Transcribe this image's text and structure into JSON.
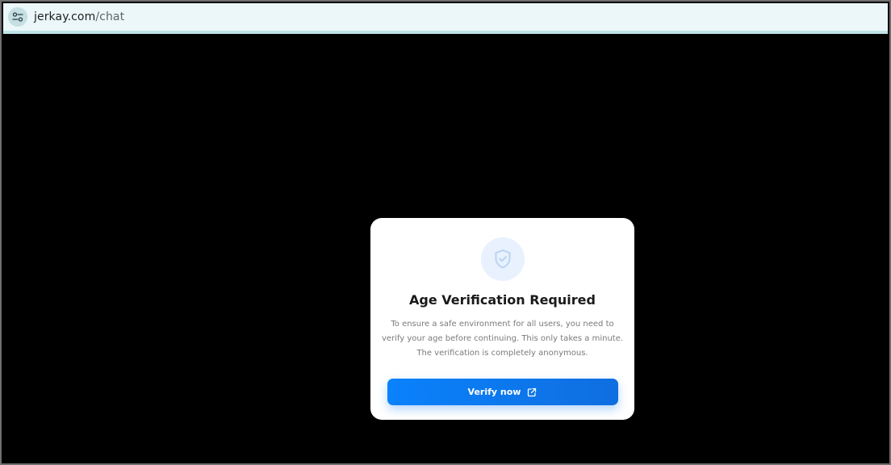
{
  "browser": {
    "url_domain": "jerkay.com",
    "url_path": "/chat",
    "site_info_icon": "tune-icon"
  },
  "modal": {
    "icon": "shield-check-icon",
    "title": "Age Verification Required",
    "description_lines": [
      "To ensure a safe environment for all users, you need to",
      "verify your age before continuing. This only takes a minute.",
      "The verification is completely anonymous."
    ],
    "button_label": "Verify now",
    "button_icon": "external-link-icon"
  },
  "colors": {
    "page_background": "#000000",
    "address_bar": "#ebf7f8",
    "accent": "#0a7cf5",
    "shield_circle": "#e8f1fd"
  }
}
